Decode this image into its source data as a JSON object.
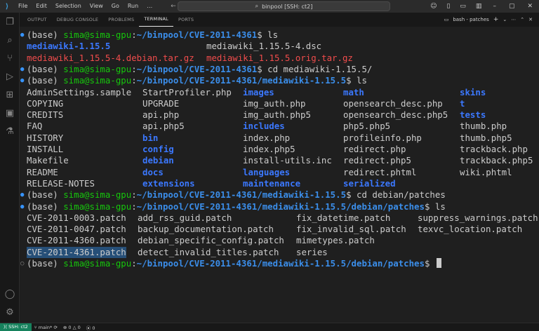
{
  "titlebar": {
    "menu": [
      "File",
      "Edit",
      "Selection",
      "View",
      "Go",
      "Run",
      "…"
    ],
    "command_center": "binpool [SSH: ct2]"
  },
  "panel": {
    "tabs": [
      "OUTPUT",
      "DEBUG CONSOLE",
      "PROBLEMS",
      "TERMINAL",
      "PORTS"
    ],
    "active_tab": "TERMINAL",
    "terminal_name": "bash - patches"
  },
  "terminal": {
    "env": "(base)",
    "userhost": "sima@sima-gpu",
    "lines": [
      {
        "type": "prompt",
        "dot": "ok",
        "path": "~/binpool/CVE-2011-4361",
        "cmd": "ls"
      },
      {
        "type": "files",
        "items": [
          {
            "t": "mediawiki-1.15.5",
            "c": "d",
            "col": 0
          },
          {
            "t": "mediawiki_1.15.5-4.dsc",
            "c": "w",
            "col": 1
          }
        ]
      },
      {
        "type": "files",
        "items": [
          {
            "t": "mediawiki_1.15.5-4.debian.tar.gz",
            "c": "gz",
            "col": 0
          },
          {
            "t": "mediawiki_1.15.5.orig.tar.gz",
            "c": "gz",
            "col": 1
          }
        ]
      },
      {
        "type": "prompt",
        "dot": "ok",
        "path": "~/binpool/CVE-2011-4361",
        "cmd": "cd mediawiki-1.15.5/"
      },
      {
        "type": "prompt",
        "dot": "ok",
        "path": "~/binpool/CVE-2011-4361/mediawiki-1.15.5",
        "cmd": "ls"
      },
      {
        "type": "grid",
        "cols": [
          0,
          165,
          308,
          451,
          617
        ],
        "items": [
          {
            "t": "AdminSettings.sample",
            "c": "w"
          },
          {
            "t": "StartProfiler.php",
            "c": "w"
          },
          {
            "t": "images",
            "c": "d"
          },
          {
            "t": "math",
            "c": "d"
          },
          {
            "t": "skins",
            "c": "d"
          }
        ]
      },
      {
        "type": "grid",
        "cols": [
          0,
          165,
          308,
          451,
          617
        ],
        "items": [
          {
            "t": "COPYING",
            "c": "w"
          },
          {
            "t": "UPGRADE",
            "c": "w"
          },
          {
            "t": "img_auth.php",
            "c": "w"
          },
          {
            "t": "opensearch_desc.php",
            "c": "w"
          },
          {
            "t": "t",
            "c": "d"
          }
        ]
      },
      {
        "type": "grid",
        "cols": [
          0,
          165,
          308,
          451,
          617
        ],
        "items": [
          {
            "t": "CREDITS",
            "c": "w"
          },
          {
            "t": "api.php",
            "c": "w"
          },
          {
            "t": "img_auth.php5",
            "c": "w"
          },
          {
            "t": "opensearch_desc.php5",
            "c": "w"
          },
          {
            "t": "tests",
            "c": "d"
          }
        ]
      },
      {
        "type": "grid",
        "cols": [
          0,
          165,
          308,
          451,
          617
        ],
        "items": [
          {
            "t": "FAQ",
            "c": "w"
          },
          {
            "t": "api.php5",
            "c": "w"
          },
          {
            "t": "includes",
            "c": "d"
          },
          {
            "t": "php5.php5",
            "c": "w"
          },
          {
            "t": "thumb.php",
            "c": "w"
          }
        ]
      },
      {
        "type": "grid",
        "cols": [
          0,
          165,
          308,
          451,
          617
        ],
        "items": [
          {
            "t": "HISTORY",
            "c": "w"
          },
          {
            "t": "bin",
            "c": "d"
          },
          {
            "t": "index.php",
            "c": "w"
          },
          {
            "t": "profileinfo.php",
            "c": "w"
          },
          {
            "t": "thumb.php5",
            "c": "w"
          }
        ]
      },
      {
        "type": "grid",
        "cols": [
          0,
          165,
          308,
          451,
          617
        ],
        "items": [
          {
            "t": "INSTALL",
            "c": "w"
          },
          {
            "t": "config",
            "c": "d"
          },
          {
            "t": "index.php5",
            "c": "w"
          },
          {
            "t": "redirect.php",
            "c": "w"
          },
          {
            "t": "trackback.php",
            "c": "w"
          }
        ]
      },
      {
        "type": "grid",
        "cols": [
          0,
          165,
          308,
          451,
          617
        ],
        "items": [
          {
            "t": "Makefile",
            "c": "w"
          },
          {
            "t": "debian",
            "c": "d"
          },
          {
            "t": "install-utils.inc",
            "c": "w"
          },
          {
            "t": "redirect.php5",
            "c": "w"
          },
          {
            "t": "trackback.php5",
            "c": "w"
          }
        ]
      },
      {
        "type": "grid",
        "cols": [
          0,
          165,
          308,
          451,
          617
        ],
        "items": [
          {
            "t": "README",
            "c": "w"
          },
          {
            "t": "docs",
            "c": "d"
          },
          {
            "t": "languages",
            "c": "d"
          },
          {
            "t": "redirect.phtml",
            "c": "w"
          },
          {
            "t": "wiki.phtml",
            "c": "w"
          }
        ]
      },
      {
        "type": "grid",
        "cols": [
          0,
          165,
          308,
          451,
          617
        ],
        "items": [
          {
            "t": "RELEASE-NOTES",
            "c": "w"
          },
          {
            "t": "extensions",
            "c": "d"
          },
          {
            "t": "maintenance",
            "c": "d"
          },
          {
            "t": "serialized",
            "c": "d"
          }
        ]
      },
      {
        "type": "prompt",
        "dot": "ok",
        "path": "~/binpool/CVE-2011-4361/mediawiki-1.15.5",
        "cmd": "cd debian/patches"
      },
      {
        "type": "prompt",
        "dot": "ok",
        "path": "~/binpool/CVE-2011-4361/mediawiki-1.15.5/debian/patches",
        "cmd": "ls"
      },
      {
        "type": "grid",
        "cols": [
          0,
          158,
          384,
          557
        ],
        "items": [
          {
            "t": "CVE-2011-0003.patch",
            "c": "w"
          },
          {
            "t": "add_rss_guid.patch",
            "c": "w"
          },
          {
            "t": "fix_datetime.patch",
            "c": "w"
          },
          {
            "t": "suppress_warnings.patch",
            "c": "w"
          }
        ]
      },
      {
        "type": "grid",
        "cols": [
          0,
          158,
          384,
          557
        ],
        "items": [
          {
            "t": "CVE-2011-0047.patch",
            "c": "w"
          },
          {
            "t": "backup_documentation.patch",
            "c": "w"
          },
          {
            "t": "fix_invalid_sql.patch",
            "c": "w"
          },
          {
            "t": "texvc_location.patch",
            "c": "w"
          }
        ]
      },
      {
        "type": "grid",
        "cols": [
          0,
          158,
          384,
          557
        ],
        "items": [
          {
            "t": "CVE-2011-4360.patch",
            "c": "w"
          },
          {
            "t": "debian_specific_config.patch",
            "c": "w"
          },
          {
            "t": "mimetypes.patch",
            "c": "w"
          }
        ]
      },
      {
        "type": "grid",
        "cols": [
          0,
          158,
          384,
          557
        ],
        "ibeam": true,
        "items": [
          {
            "t": "CVE-2011-4361.patch",
            "c": "w",
            "sel": true
          },
          {
            "t": "detect_invalid_titles.patch",
            "c": "w"
          },
          {
            "t": "series",
            "c": "w"
          }
        ]
      },
      {
        "type": "prompt",
        "dot": "idle",
        "path": "~/binpool/CVE-2011-4361/mediawiki-1.15.5/debian/patches",
        "cmd": "",
        "cursor": true
      }
    ]
  },
  "statusbar": {
    "remote": "SSH: ct2",
    "branch": "main*",
    "sync": "⟳",
    "errors": "0",
    "warnings": "0",
    "ports": "0"
  },
  "colors": {
    "prompt_user": "#16c60c",
    "prompt_path": "#3b8eea",
    "directory": "#3b78ff",
    "archive": "#f14c4c",
    "selection": "#264f78",
    "remote_badge": "#16825d"
  }
}
